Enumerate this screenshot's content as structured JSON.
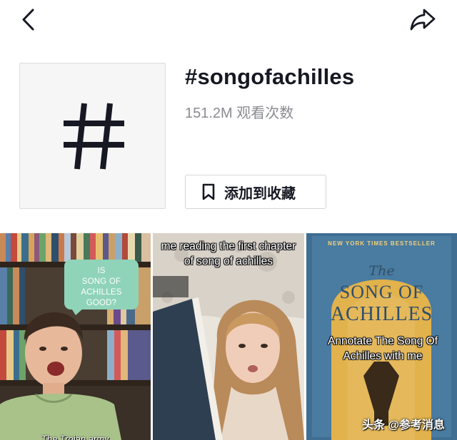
{
  "hashtag": {
    "title": "#songofachilles",
    "views": "151.2M 观看次数",
    "favorite_label": "添加到收藏"
  },
  "videos": [
    {
      "bubble_lines": [
        "IS",
        "SONG OF ACHILLES",
        "GOOD?"
      ],
      "bottom_caption": "The Trojan army"
    },
    {
      "caption": "me reading the first chapter of song of achilles"
    },
    {
      "book_header": "NEW YORK TIMES BESTSELLER",
      "book_the": "The",
      "book_title_line1": "SONG OF",
      "book_title_line2": "ACHILLES",
      "caption": "Annotate The Song Of Achilles with me",
      "watermark": "头条 @参考消息"
    }
  ],
  "icons": {
    "back": "back-chevron-icon",
    "share": "share-arrow-icon",
    "hashtag": "hashtag-icon",
    "bookmark": "bookmark-icon"
  },
  "colors": {
    "text_primary": "#161823",
    "text_secondary": "#8a8b91",
    "bubble": "#8fd3b9",
    "book_blue": "#3f6e92",
    "book_gold": "#e2b24c"
  }
}
